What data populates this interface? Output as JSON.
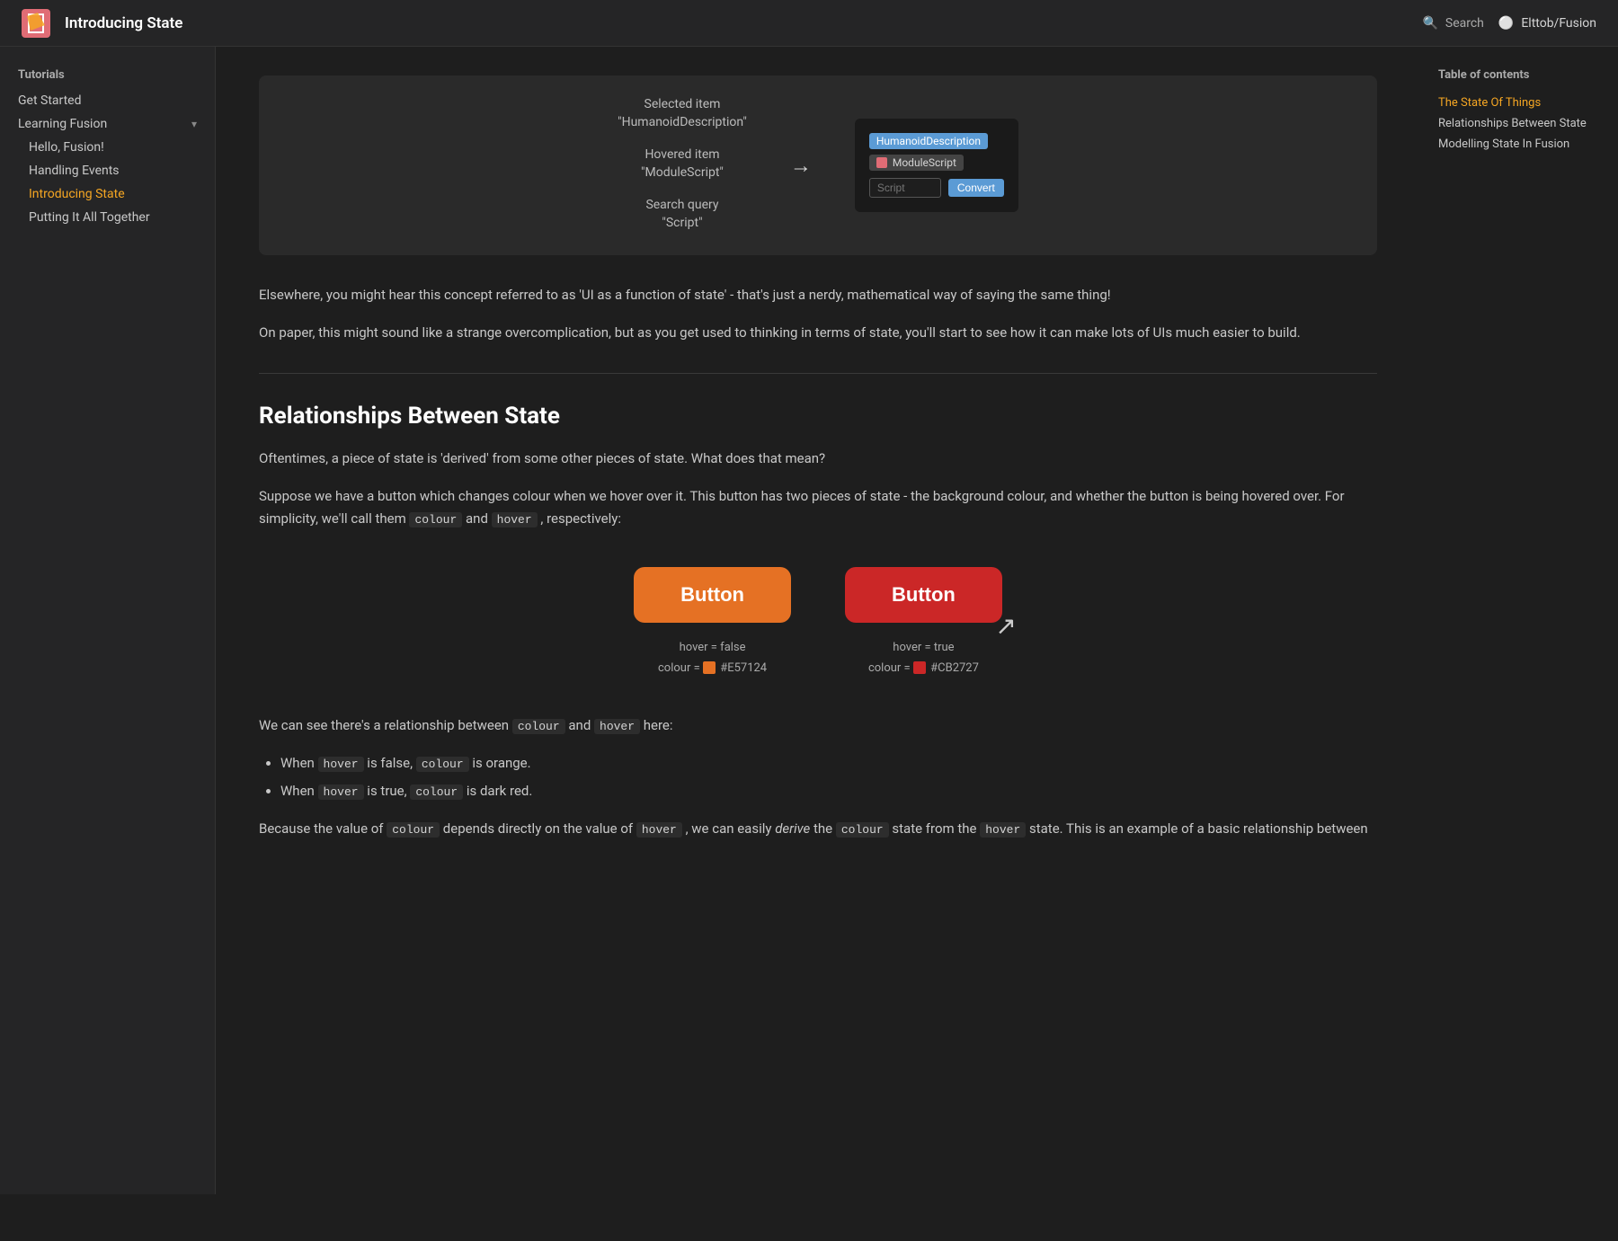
{
  "topnav": {
    "title": "Introducing State",
    "search_label": "Search",
    "github_label": "Elttob/Fusion"
  },
  "sidebar": {
    "tutorials_label": "Tutorials",
    "get_started": "Get Started",
    "learning_fusion": "Learning Fusion",
    "items": [
      {
        "label": "Hello, Fusion!",
        "indent": true,
        "active": false
      },
      {
        "label": "Handling Events",
        "indent": true,
        "active": false
      },
      {
        "label": "Introducing State",
        "indent": true,
        "active": true
      },
      {
        "label": "Putting It All Together",
        "indent": true,
        "active": false
      }
    ]
  },
  "toc": {
    "title": "Table of contents",
    "items": [
      {
        "label": "The State Of Things",
        "active": true
      },
      {
        "label": "Relationships Between State",
        "active": false
      },
      {
        "label": "Modelling State In Fusion",
        "active": false
      }
    ]
  },
  "demo": {
    "selected_item_label": "Selected item",
    "selected_item_value": "\"HumanoidDescription\"",
    "hovered_item_label": "Hovered item",
    "hovered_item_value": "\"ModuleScript\"",
    "search_query_label": "Search query",
    "search_query_value": "\"Script\"",
    "convert_button": "Convert",
    "input_placeholder": "Script",
    "ui_item1": "HumanoidDescription",
    "ui_item2": "ModuleScript"
  },
  "main": {
    "para1": "Elsewhere, you might hear this concept referred to as 'UI as a function of state' - that's just a nerdy, mathematical way of saying the same thing!",
    "para2": "On paper, this might sound like a strange overcomplication, but as you get used to thinking in terms of state, you'll start to see how it can make lots of UIs much easier to build.",
    "section_heading": "Relationships Between State",
    "para3": "Oftentimes, a piece of state is 'derived' from some other pieces of state. What does that mean?",
    "para4": "Suppose we have a button which changes colour when we hover over it. This button has two pieces of state - the background colour, and whether the button is being hovered over. For simplicity, we'll call them",
    "code_colour": "colour",
    "and_text": "and",
    "code_hover": "hover",
    "respectively_text": ", respectively:",
    "btn_label": "Button",
    "btn_label2": "Button",
    "state1_hover": "hover = false",
    "state1_colour_label": "colour = ",
    "state1_colour_hex": "#E57124",
    "state2_hover": "hover = true",
    "state2_colour_label": "colour = ",
    "state2_colour_hex": "#CB2727",
    "para5_start": "We can see there's a relationship between",
    "code_colour2": "colour",
    "and2": "and",
    "code_hover2": "hover",
    "here": "here:",
    "bullet1_start": "When",
    "bullet1_code": "hover",
    "bullet1_mid": "is false,",
    "bullet1_code2": "colour",
    "bullet1_end": "is orange.",
    "bullet2_start": "When",
    "bullet2_code": "hover",
    "bullet2_mid": "is true,",
    "bullet2_code2": "colour",
    "bullet2_end": "is dark red.",
    "para6_start": "Because the value of",
    "code_colour3": "colour",
    "para6_mid": "depends directly on the value of",
    "code_hover3": "hover",
    "para6_end": ", we can easily",
    "derive_text": "derive",
    "para6_end2": "the",
    "code_colour4": "colour",
    "para6_end3": "state from the",
    "code_hover4": "hover",
    "para6_end4": "state. This is an example of a basic relationship between"
  }
}
